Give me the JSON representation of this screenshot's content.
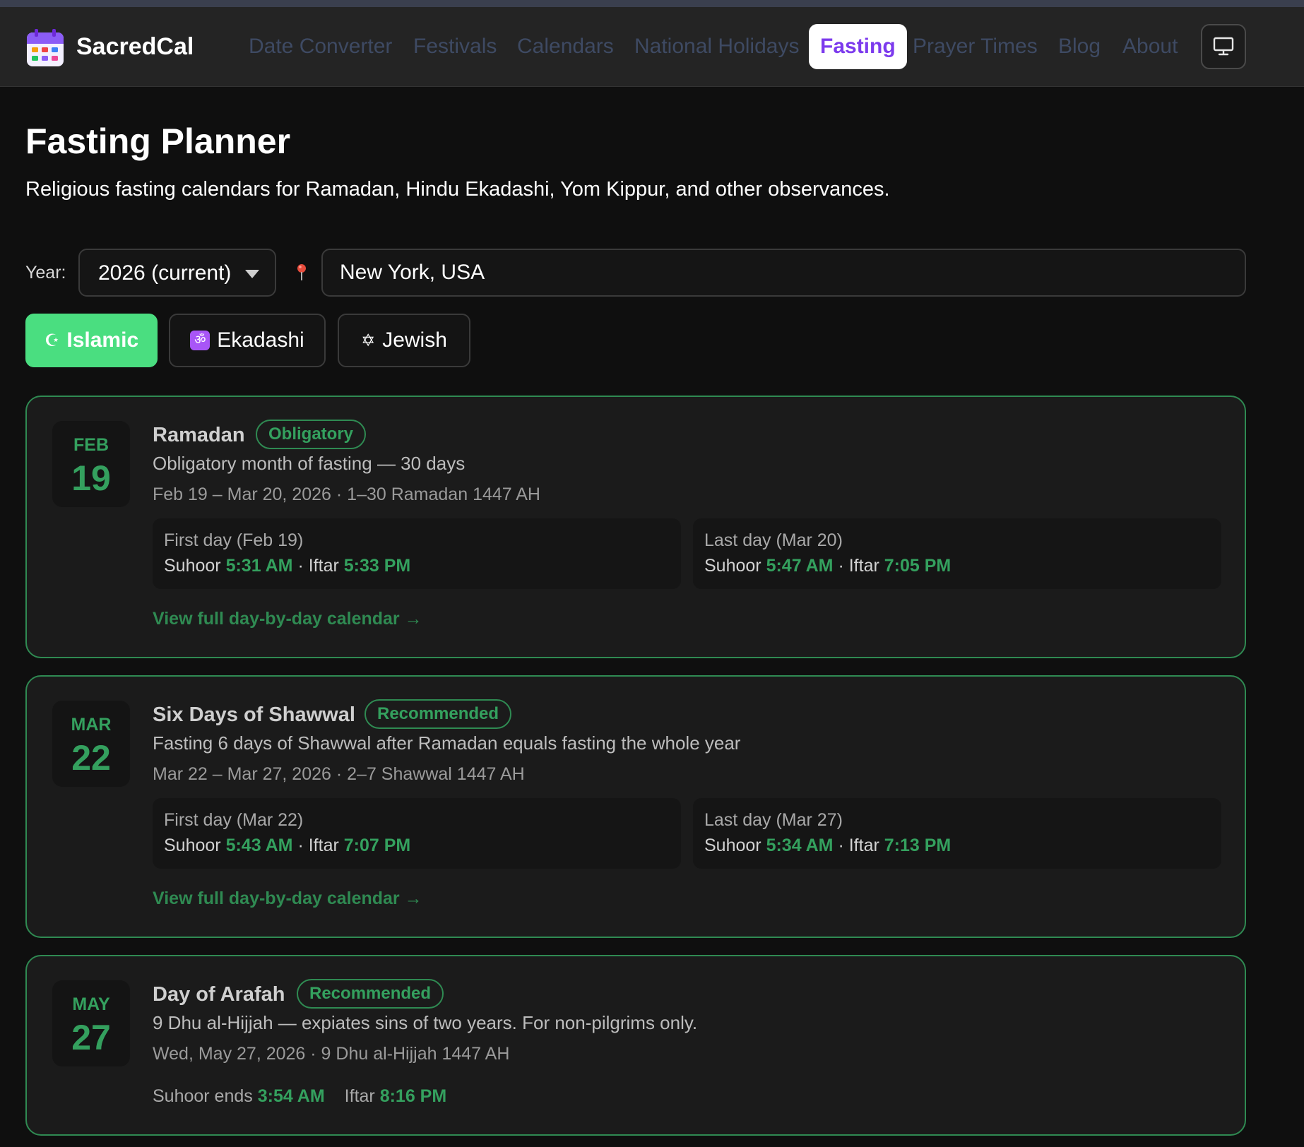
{
  "app": {
    "brand": "SacredCal"
  },
  "nav": {
    "items": [
      {
        "label": "Date Converter"
      },
      {
        "label": "Festivals"
      },
      {
        "label": "Calendars"
      },
      {
        "label": "National Holidays"
      },
      {
        "label": "Fasting",
        "active": true
      },
      {
        "label": "Prayer Times"
      },
      {
        "label": "Blog"
      },
      {
        "label": "About"
      }
    ],
    "display_icon": "monitor-icon"
  },
  "page": {
    "title": "Fasting Planner",
    "subtitle": "Religious fasting calendars for Ramadan, Hindu Ekadashi, Yom Kippur, and other observances."
  },
  "controls": {
    "year_label": "Year:",
    "year_value": "2026 (current)",
    "location_icon": "map-pin-icon",
    "location_value": "New York, USA"
  },
  "filters": [
    {
      "icon": "☪",
      "label": "Islamic",
      "active": true
    },
    {
      "icon": "ॐ",
      "label": "Ekadashi",
      "active": false
    },
    {
      "icon": "✡",
      "label": "Jewish",
      "active": false
    }
  ],
  "colors": {
    "accent_green": "#34a05e",
    "active_filter": "#4ade80",
    "active_nav_text": "#7c3aed",
    "card_border": "#2f8a52"
  },
  "events": [
    {
      "month": "FEB",
      "day": "19",
      "title": "Ramadan",
      "badge": "Obligatory",
      "description": "Obligatory month of fasting — 30 days",
      "range": "Feb 19 – Mar 20, 2026 · 1–30 Ramadan 1447 AH",
      "first": {
        "label": "First day (Feb 19)",
        "suhoor_label": "Suhoor",
        "suhoor": "5:31 AM",
        "sep": " · ",
        "iftar_label": "Iftar",
        "iftar": "5:33 PM"
      },
      "last": {
        "label": "Last day (Mar 20)",
        "suhoor_label": "Suhoor",
        "suhoor": "5:47 AM",
        "sep": " · ",
        "iftar_label": "Iftar",
        "iftar": "7:05 PM"
      },
      "link": "View full day-by-day calendar →"
    },
    {
      "month": "MAR",
      "day": "22",
      "title": "Six Days of Shawwal",
      "badge": "Recommended",
      "description": "Fasting 6 days of Shawwal after Ramadan equals fasting the whole year",
      "range": "Mar 22 – Mar 27, 2026 · 2–7 Shawwal 1447 AH",
      "first": {
        "label": "First day (Mar 22)",
        "suhoor_label": "Suhoor",
        "suhoor": "5:43 AM",
        "sep": " · ",
        "iftar_label": "Iftar",
        "iftar": "7:07 PM"
      },
      "last": {
        "label": "Last day (Mar 27)",
        "suhoor_label": "Suhoor",
        "suhoor": "5:34 AM",
        "sep": " · ",
        "iftar_label": "Iftar",
        "iftar": "7:13 PM"
      },
      "link": "View full day-by-day calendar →"
    },
    {
      "month": "MAY",
      "day": "27",
      "title": "Day of Arafah",
      "badge": "Recommended",
      "description": "9 Dhu al-Hijjah — expiates sins of two years. For non-pilgrims only.",
      "range": "Wed, May 27, 2026 · 9 Dhu al-Hijjah 1447 AH",
      "suhoor_ends_label": "Suhoor ends",
      "suhoor_ends": "3:54 AM",
      "iftar_label": "Iftar",
      "iftar": "8:16 PM"
    }
  ]
}
